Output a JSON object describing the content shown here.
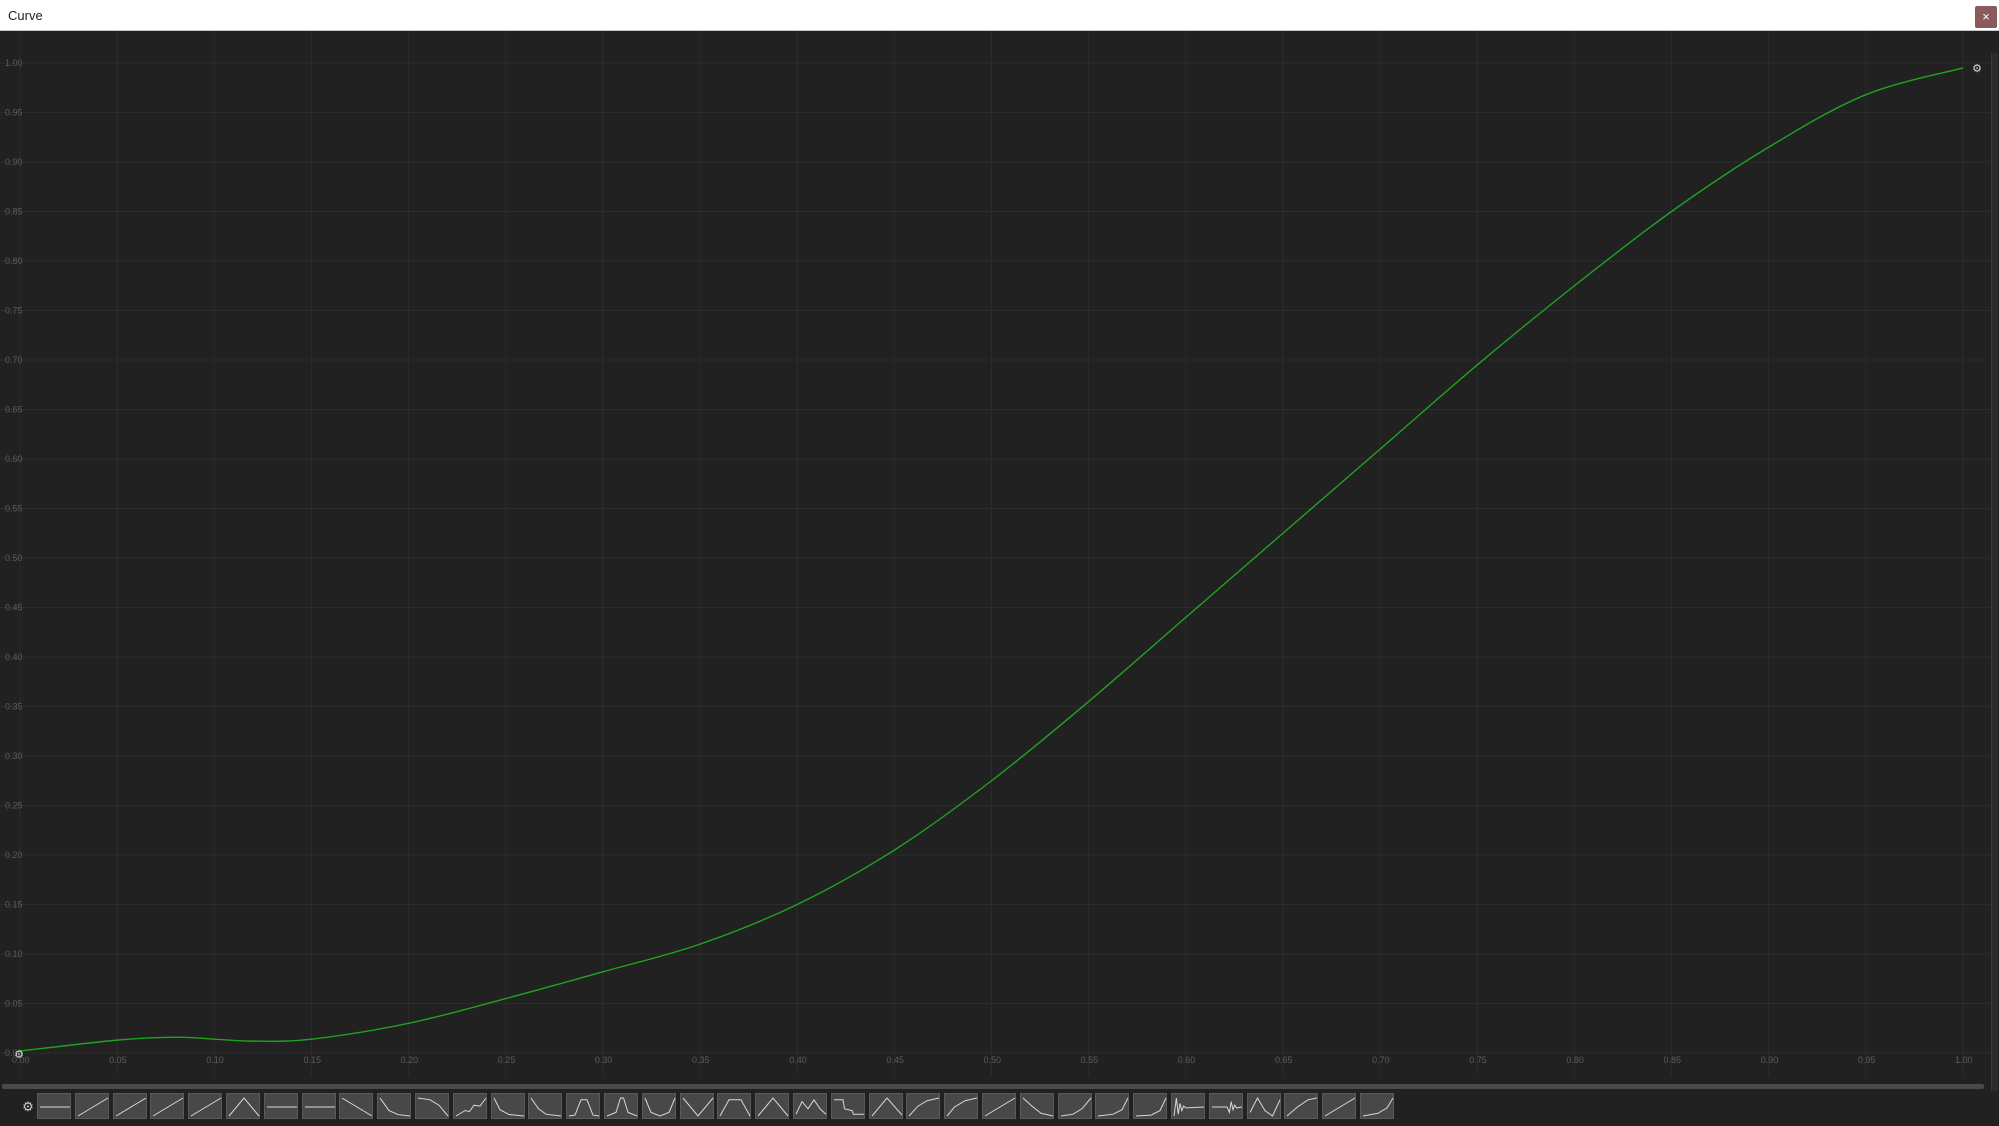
{
  "window": {
    "title": "Curve",
    "close_label": "×"
  },
  "icons": {
    "close": "close-icon",
    "settings": "gear-icon",
    "keyframe_menu": "gear-icon"
  },
  "colors": {
    "background": "#212121",
    "grid": "#2c2c2c",
    "curve": "#1fa31f",
    "axis_label": "#5c5c5c",
    "preset_bg": "#484848",
    "preset_line": "#d8d8d8",
    "close_button": "#8b5a5a"
  },
  "chart_data": {
    "type": "line",
    "xlim": [
      0.0,
      1.0
    ],
    "ylim": [
      0.0,
      1.0
    ],
    "grid": true,
    "x_ticks": [
      "0.00",
      "0.05",
      "0.10",
      "0.15",
      "0.20",
      "0.25",
      "0.30",
      "0.35",
      "0.40",
      "0.45",
      "0.50",
      "0.55",
      "0.60",
      "0.65",
      "0.70",
      "0.75",
      "0.80",
      "0.85",
      "0.90",
      "0.95",
      "1.00"
    ],
    "y_ticks": [
      "0.00",
      "0.05",
      "0.10",
      "0.15",
      "0.20",
      "0.25",
      "0.30",
      "0.35",
      "0.40",
      "0.45",
      "0.50",
      "0.55",
      "0.60",
      "0.65",
      "0.70",
      "0.75",
      "0.80",
      "0.85",
      "0.90",
      "0.95",
      "1.00"
    ],
    "series": [
      {
        "x": [
          0.0,
          0.05,
          0.08,
          0.1,
          0.12,
          0.15,
          0.2,
          0.25,
          0.3,
          0.35,
          0.4,
          0.45,
          0.5,
          0.55,
          0.6,
          0.65,
          0.7,
          0.75,
          0.8,
          0.85,
          0.9,
          0.95,
          1.0
        ],
        "y": [
          0.002,
          0.013,
          0.016,
          0.014,
          0.012,
          0.014,
          0.03,
          0.055,
          0.082,
          0.11,
          0.15,
          0.205,
          0.275,
          0.355,
          0.44,
          0.525,
          0.61,
          0.695,
          0.775,
          0.85,
          0.915,
          0.968,
          0.995
        ]
      }
    ],
    "keyframes": [
      {
        "x": 0.0,
        "y": 0.0
      },
      {
        "x": 1.0,
        "y": 1.0
      }
    ]
  },
  "presets": [
    {
      "name": "constant",
      "shape": [
        [
          0,
          0.5
        ],
        [
          1,
          0.5
        ]
      ]
    },
    {
      "name": "linear-1",
      "shape": [
        [
          0,
          0
        ],
        [
          1,
          1
        ]
      ]
    },
    {
      "name": "linear-2",
      "shape": [
        [
          0,
          0
        ],
        [
          1,
          1
        ]
      ]
    },
    {
      "name": "linear-3",
      "shape": [
        [
          0,
          0
        ],
        [
          1,
          1
        ]
      ]
    },
    {
      "name": "linear-4",
      "shape": [
        [
          0,
          0
        ],
        [
          1,
          1
        ]
      ]
    },
    {
      "name": "bump",
      "shape": [
        [
          0,
          0
        ],
        [
          0.5,
          1
        ],
        [
          1,
          0
        ]
      ]
    },
    {
      "name": "flat-mid-1",
      "shape": [
        [
          0,
          0.5
        ],
        [
          1,
          0.5
        ]
      ]
    },
    {
      "name": "flat-mid-2",
      "shape": [
        [
          0,
          0.5
        ],
        [
          1,
          0.5
        ]
      ]
    },
    {
      "name": "linear-down",
      "shape": [
        [
          0,
          1
        ],
        [
          1,
          0
        ]
      ]
    },
    {
      "name": "ease-out-down",
      "shape": [
        [
          0,
          1
        ],
        [
          0.3,
          0.3
        ],
        [
          0.6,
          0.08
        ],
        [
          1,
          0
        ]
      ]
    },
    {
      "name": "ease-in-down",
      "shape": [
        [
          0,
          1
        ],
        [
          0.4,
          0.9
        ],
        [
          0.7,
          0.6
        ],
        [
          1,
          0
        ]
      ]
    },
    {
      "name": "wobble-up",
      "shape": [
        [
          0,
          0
        ],
        [
          0.3,
          0.3
        ],
        [
          0.45,
          0.25
        ],
        [
          0.6,
          0.6
        ],
        [
          0.8,
          0.55
        ],
        [
          1,
          1
        ]
      ]
    },
    {
      "name": "ease-out-down-2",
      "shape": [
        [
          0,
          1
        ],
        [
          0.2,
          0.35
        ],
        [
          0.5,
          0.08
        ],
        [
          1,
          0
        ]
      ]
    },
    {
      "name": "ease-out-down-3",
      "shape": [
        [
          0,
          1
        ],
        [
          0.25,
          0.4
        ],
        [
          0.5,
          0.1
        ],
        [
          1,
          0
        ]
      ]
    },
    {
      "name": "bell-1",
      "shape": [
        [
          0,
          0
        ],
        [
          0.2,
          0.05
        ],
        [
          0.4,
          0.9
        ],
        [
          0.6,
          0.9
        ],
        [
          0.8,
          0.05
        ],
        [
          1,
          0
        ]
      ]
    },
    {
      "name": "bell-2",
      "shape": [
        [
          0,
          0
        ],
        [
          0.3,
          0.2
        ],
        [
          0.45,
          1
        ],
        [
          0.55,
          1
        ],
        [
          0.7,
          0.2
        ],
        [
          1,
          0
        ]
      ]
    },
    {
      "name": "valley-1",
      "shape": [
        [
          0,
          1
        ],
        [
          0.2,
          0.2
        ],
        [
          0.5,
          0
        ],
        [
          0.8,
          0.2
        ],
        [
          1,
          1
        ]
      ]
    },
    {
      "name": "v-shape",
      "shape": [
        [
          0,
          1
        ],
        [
          0.5,
          0
        ],
        [
          1,
          1
        ]
      ]
    },
    {
      "name": "bell-3",
      "shape": [
        [
          0,
          0
        ],
        [
          0.3,
          0.9
        ],
        [
          0.7,
          0.9
        ],
        [
          1,
          0
        ]
      ]
    },
    {
      "name": "peak",
      "shape": [
        [
          0,
          0
        ],
        [
          0.5,
          1
        ],
        [
          1,
          0
        ]
      ]
    },
    {
      "name": "double-hump",
      "shape": [
        [
          0,
          0.1
        ],
        [
          0.2,
          0.8
        ],
        [
          0.4,
          0.4
        ],
        [
          0.6,
          0.9
        ],
        [
          0.8,
          0.4
        ],
        [
          1,
          0.1
        ]
      ]
    },
    {
      "name": "step-down",
      "shape": [
        [
          0,
          0.9
        ],
        [
          0.3,
          0.9
        ],
        [
          0.35,
          0.4
        ],
        [
          0.6,
          0.3
        ],
        [
          0.65,
          0.1
        ],
        [
          1,
          0.1
        ]
      ]
    },
    {
      "name": "peak-2",
      "shape": [
        [
          0,
          0
        ],
        [
          0.5,
          1
        ],
        [
          1,
          0.05
        ]
      ]
    },
    {
      "name": "ease-out-up",
      "shape": [
        [
          0,
          0
        ],
        [
          0.3,
          0.55
        ],
        [
          0.6,
          0.85
        ],
        [
          1,
          1
        ]
      ]
    },
    {
      "name": "ease-out-up-2",
      "shape": [
        [
          0,
          0
        ],
        [
          0.25,
          0.5
        ],
        [
          0.6,
          0.85
        ],
        [
          1,
          1
        ]
      ]
    },
    {
      "name": "linear-up-5",
      "shape": [
        [
          0,
          0
        ],
        [
          1,
          1
        ]
      ]
    },
    {
      "name": "ease-down-4",
      "shape": [
        [
          0,
          1
        ],
        [
          0.3,
          0.55
        ],
        [
          0.6,
          0.15
        ],
        [
          1,
          0
        ]
      ]
    },
    {
      "name": "ease-in-up",
      "shape": [
        [
          0,
          0
        ],
        [
          0.4,
          0.1
        ],
        [
          0.7,
          0.4
        ],
        [
          1,
          1
        ]
      ]
    },
    {
      "name": "ease-in-up-2",
      "shape": [
        [
          0,
          0
        ],
        [
          0.5,
          0.1
        ],
        [
          0.8,
          0.35
        ],
        [
          1,
          1
        ]
      ]
    },
    {
      "name": "ease-in-up-3",
      "shape": [
        [
          0,
          0
        ],
        [
          0.5,
          0.05
        ],
        [
          0.8,
          0.3
        ],
        [
          1,
          1
        ]
      ]
    },
    {
      "name": "elastic-1",
      "shape": [
        [
          0,
          0
        ],
        [
          0.08,
          1
        ],
        [
          0.14,
          0.1
        ],
        [
          0.2,
          0.7
        ],
        [
          0.26,
          0.3
        ],
        [
          0.32,
          0.55
        ],
        [
          0.4,
          0.45
        ],
        [
          1,
          0.5
        ]
      ]
    },
    {
      "name": "elastic-2",
      "shape": [
        [
          0,
          0.5
        ],
        [
          0.5,
          0.5
        ],
        [
          0.58,
          0.2
        ],
        [
          0.64,
          0.8
        ],
        [
          0.7,
          0.35
        ],
        [
          0.76,
          0.6
        ],
        [
          0.82,
          0.45
        ],
        [
          1,
          0.5
        ]
      ]
    },
    {
      "name": "wave",
      "shape": [
        [
          0,
          0.2
        ],
        [
          0.25,
          1
        ],
        [
          0.5,
          0.3
        ],
        [
          0.75,
          0
        ],
        [
          1,
          0.9
        ]
      ]
    },
    {
      "name": "ease-out-up-3",
      "shape": [
        [
          0,
          0
        ],
        [
          0.35,
          0.5
        ],
        [
          0.7,
          0.9
        ],
        [
          1,
          1
        ]
      ]
    },
    {
      "name": "linear-up-6",
      "shape": [
        [
          0,
          0
        ],
        [
          1,
          1
        ]
      ]
    },
    {
      "name": "ease-in-up-4",
      "shape": [
        [
          0,
          0
        ],
        [
          0.5,
          0.15
        ],
        [
          0.8,
          0.45
        ],
        [
          1,
          1
        ]
      ]
    }
  ]
}
